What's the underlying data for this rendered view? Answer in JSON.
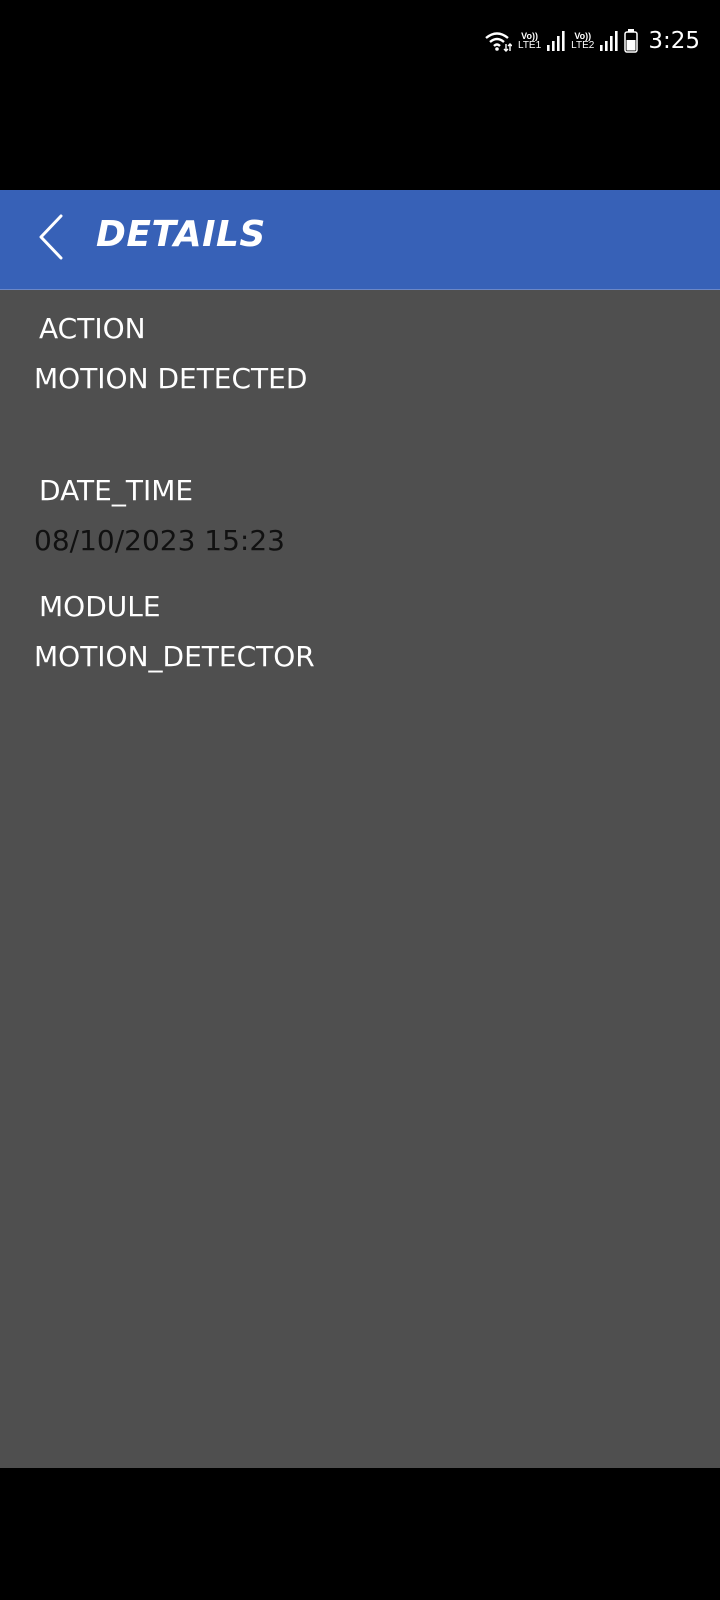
{
  "status_bar": {
    "time": "3:25",
    "sim1": {
      "vo": "Vo))",
      "lte": "LTE1"
    },
    "sim2": {
      "vo": "Vo))",
      "lte": "LTE2"
    },
    "icons": [
      "wifi-icon",
      "signal-icon",
      "battery-icon"
    ]
  },
  "header": {
    "title": "DETAILS",
    "back_icon": "chevron-left-icon",
    "color": "#3761b7"
  },
  "details": {
    "action_label": "ACTION",
    "action_value": "MOTION DETECTED",
    "date_time_label": "DATE_TIME",
    "date_time_value": "08/10/2023 15:23",
    "module_label": "MODULE",
    "module_value": "MOTION_DETECTOR"
  },
  "colors": {
    "content_background": "#4f4f4f",
    "text": "#ffffff"
  }
}
